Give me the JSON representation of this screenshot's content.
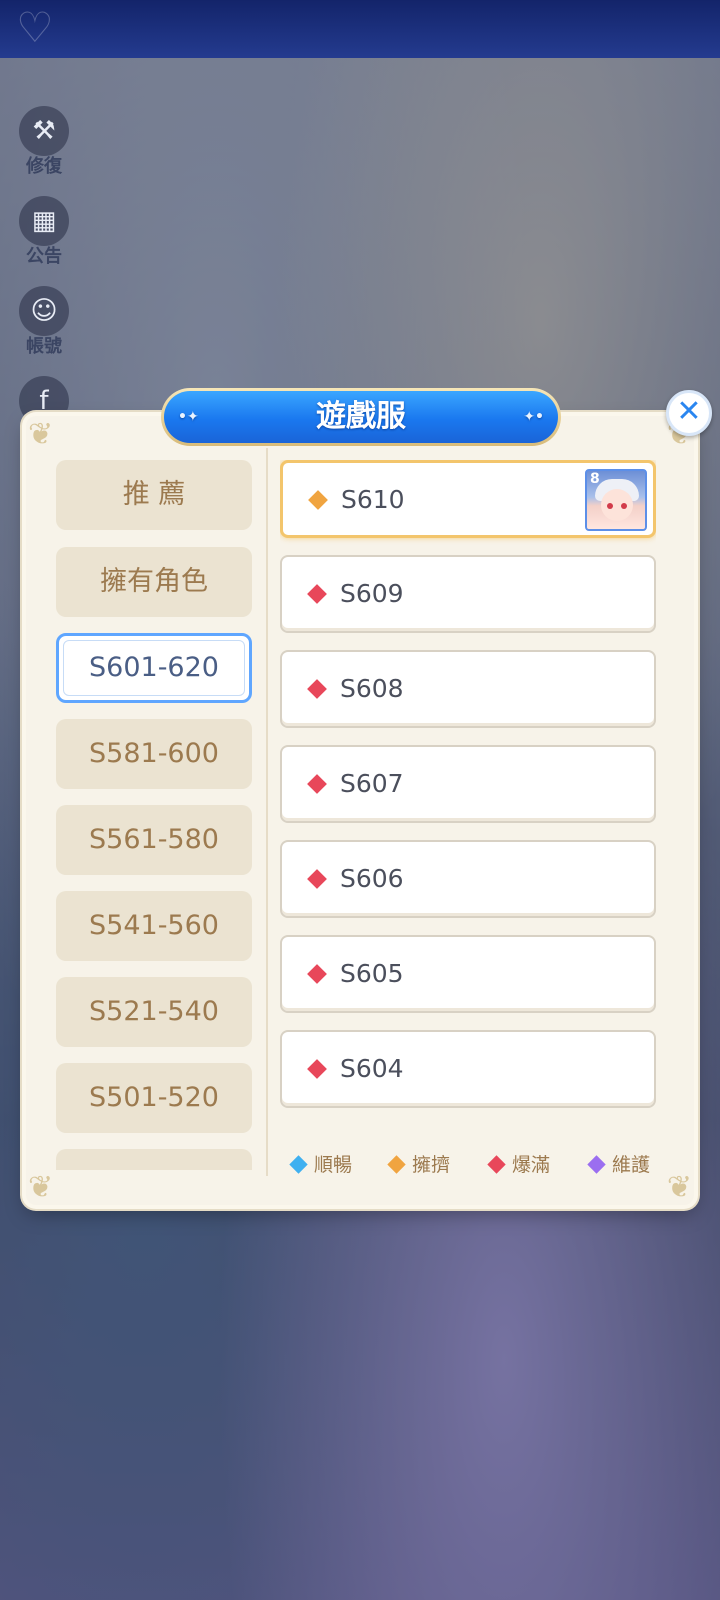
{
  "window": {
    "title": "遊戲服"
  },
  "sidebar": {
    "items": [
      {
        "label": "修復",
        "icon": "wrench-icon"
      },
      {
        "label": "公告",
        "icon": "calendar-icon"
      },
      {
        "label": "帳號",
        "icon": "account-icon"
      },
      {
        "label": "F",
        "icon": "facebook-icon"
      }
    ]
  },
  "categories": [
    {
      "label": "推 薦"
    },
    {
      "label": "擁有角色"
    },
    {
      "label": "S601-620",
      "active": true
    },
    {
      "label": "S581-600"
    },
    {
      "label": "S561-580"
    },
    {
      "label": "S541-560"
    },
    {
      "label": "S521-540"
    },
    {
      "label": "S501-520"
    }
  ],
  "servers": [
    {
      "name": "S610",
      "status": "擁擠",
      "selected": true,
      "character_level": "8"
    },
    {
      "name": "S609",
      "status": "爆滿"
    },
    {
      "name": "S608",
      "status": "爆滿"
    },
    {
      "name": "S607",
      "status": "爆滿"
    },
    {
      "name": "S606",
      "status": "爆滿"
    },
    {
      "name": "S605",
      "status": "爆滿"
    },
    {
      "name": "S604",
      "status": "爆滿"
    }
  ],
  "legend": [
    {
      "label": "順暢",
      "color": "#3fb0f0"
    },
    {
      "label": "擁擠",
      "color": "#f0a440"
    },
    {
      "label": "爆滿",
      "color": "#e8475a"
    },
    {
      "label": "維護",
      "color": "#9b6ef0"
    }
  ],
  "colors": {
    "smooth": "#3fb0f0",
    "crowded": "#f0a440",
    "full": "#e8475a",
    "maintenance": "#9b6ef0",
    "accent": "#1a78ef"
  }
}
